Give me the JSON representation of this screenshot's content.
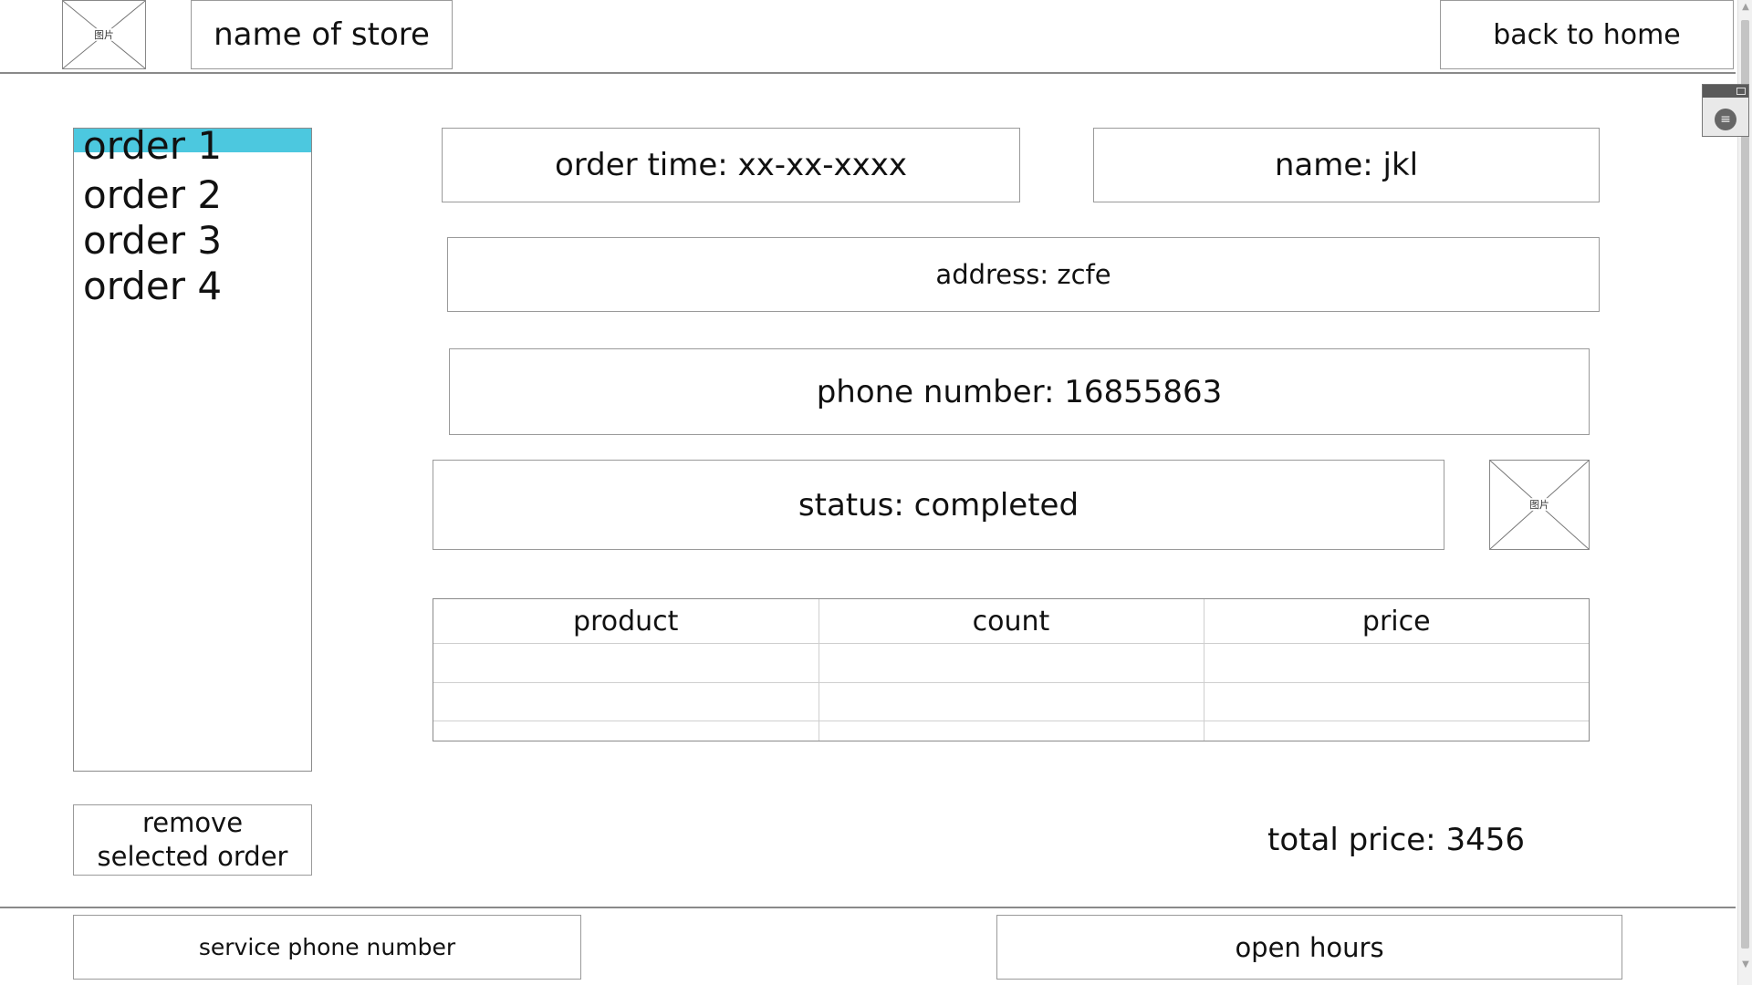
{
  "header": {
    "logo_icon": "image-placeholder-icon",
    "placeholder_caption": "图片",
    "store_name": "name of store",
    "back_home_label": "back to home"
  },
  "orders": {
    "items": [
      {
        "label": "order 1",
        "selected": true
      },
      {
        "label": "order 2",
        "selected": false
      },
      {
        "label": "order 3",
        "selected": false
      },
      {
        "label": "order 4",
        "selected": false
      }
    ],
    "remove_label": "remove selected order",
    "selected_color": "#4cc8df"
  },
  "details": {
    "order_time": "order time: xx-xx-xxxx",
    "name": "name: jkl",
    "address": "address: zcfe",
    "phone": "phone number: 16855863",
    "status": "status: completed",
    "status_image_icon": "image-placeholder-icon"
  },
  "products_table": {
    "columns": [
      "product",
      "count",
      "price"
    ]
  },
  "total": "total price: 3456",
  "footer": {
    "service_phone_label": "service phone number",
    "open_hours_label": "open hours"
  }
}
